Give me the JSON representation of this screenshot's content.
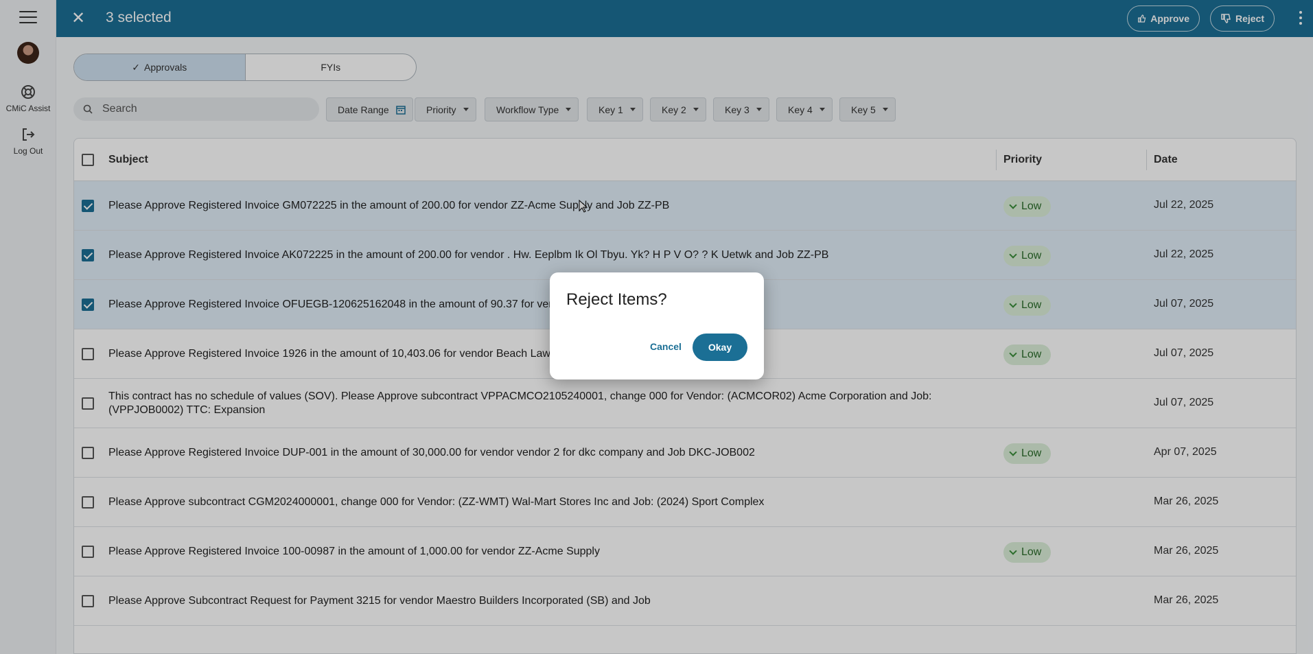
{
  "rail": {
    "assist_label": "CMiC Assist",
    "logout_label": "Log Out"
  },
  "topbar": {
    "title": "3 selected",
    "approve_label": "Approve",
    "reject_label": "Reject"
  },
  "tabs": {
    "approvals": "Approvals",
    "fyis": "FYIs"
  },
  "search": {
    "placeholder": "Search"
  },
  "filters": [
    "Date Range",
    "Priority",
    "Workflow Type",
    "Key 1",
    "Key 2",
    "Key 3",
    "Key 4",
    "Key 5"
  ],
  "table": {
    "headers": {
      "subject": "Subject",
      "priority": "Priority",
      "date": "Date"
    },
    "rows": [
      {
        "selected": true,
        "subject": "Please Approve Registered Invoice GM072225 in the amount of 200.00 for vendor ZZ-Acme Supply and Job ZZ-PB",
        "priority": "Low",
        "date": "Jul 22, 2025"
      },
      {
        "selected": true,
        "subject": "Please Approve Registered Invoice AK072225 in the amount of 200.00 for vendor . Hw. Eeplbm Ik Ol Tbyu. Yk? H P V O? ? K Uetwk and Job ZZ-PB",
        "priority": "Low",
        "date": "Jul 22, 2025"
      },
      {
        "selected": true,
        "subject": "Please Approve Registered Invoice OFUEGB-120625162048 in the amount of 90.37 for vend",
        "priority": "Low",
        "date": "Jul 07, 2025"
      },
      {
        "selected": false,
        "subject": "Please Approve Registered Invoice 1926 in the amount of 10,403.06 for vendor Beach Lawn",
        "priority": "Low",
        "date": "Jul 07, 2025"
      },
      {
        "selected": false,
        "subject": "This contract has no schedule of values (SOV). Please Approve subcontract VPPACMCO2105240001, change 000 for Vendor: (ACMCOR02) Acme Corporation and Job: (VPPJOB0002) TTC: Expansion",
        "priority": "",
        "date": "Jul 07, 2025"
      },
      {
        "selected": false,
        "subject": "Please Approve Registered Invoice DUP-001 in the amount of 30,000.00 for vendor vendor 2 for dkc company and Job DKC-JOB002",
        "priority": "Low",
        "date": "Apr 07, 2025"
      },
      {
        "selected": false,
        "subject": "Please Approve subcontract CGM2024000001, change 000 for Vendor: (ZZ-WMT) Wal-Mart Stores Inc and Job: (2024) Sport Complex",
        "priority": "",
        "date": "Mar 26, 2025"
      },
      {
        "selected": false,
        "subject": "Please Approve Registered Invoice 100-00987 in the amount of 1,000.00 for vendor ZZ-Acme Supply",
        "priority": "Low",
        "date": "Mar 26, 2025"
      },
      {
        "selected": false,
        "subject": "Please Approve Subcontract Request for Payment 3215 for vendor Maestro Builders Incorporated (SB) and Job",
        "priority": "",
        "date": "Mar 26, 2025"
      }
    ]
  },
  "dialog": {
    "title": "Reject Items?",
    "cancel_label": "Cancel",
    "okay_label": "Okay"
  }
}
